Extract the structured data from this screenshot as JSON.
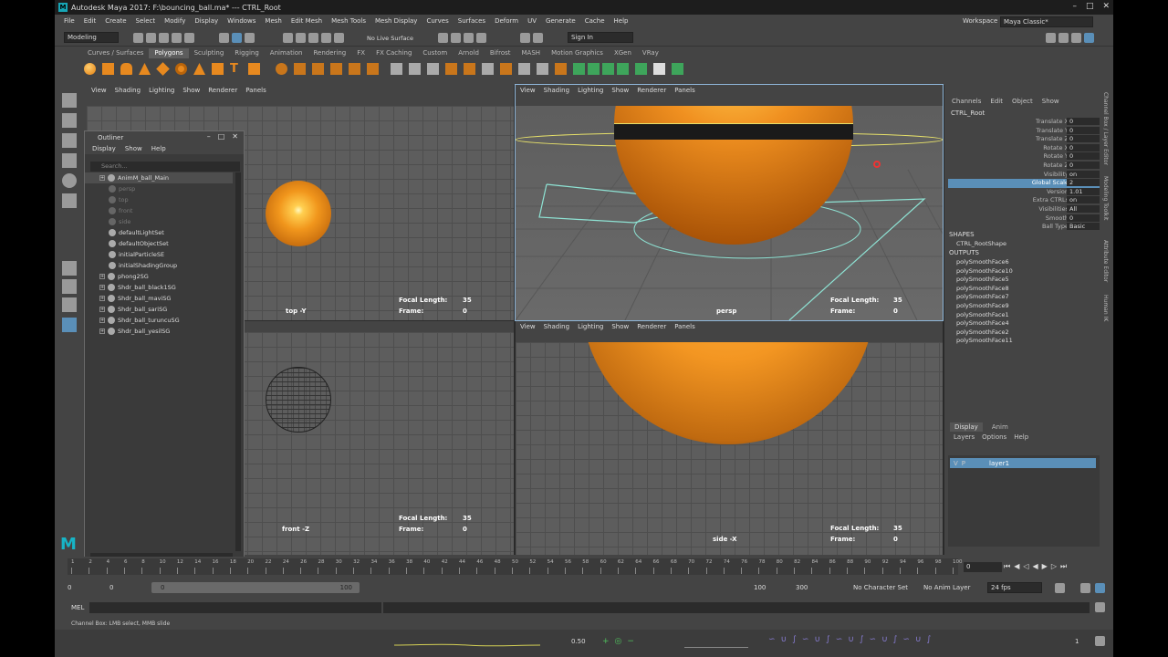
{
  "window": {
    "title": "Autodesk Maya 2017: F:\\bouncing_ball.ma*  ---  CTRL_Root"
  },
  "menu": [
    "File",
    "Edit",
    "Create",
    "Select",
    "Modify",
    "Display",
    "Windows",
    "Mesh",
    "Edit Mesh",
    "Mesh Tools",
    "Mesh Display",
    "Curves",
    "Surfaces",
    "Deform",
    "UV",
    "Generate",
    "Cache",
    "Help"
  ],
  "workspace": {
    "label": "Workspace :",
    "value": "Maya Classic*"
  },
  "status": {
    "mode": "Modeling",
    "live": "No Live Surface",
    "signin": "Sign In"
  },
  "shelf_tabs": [
    "Curves / Surfaces",
    "Polygons",
    "Sculpting",
    "Rigging",
    "Animation",
    "Rendering",
    "FX",
    "FX Caching",
    "Custom",
    "Arnold",
    "Bifrost",
    "MASH",
    "Motion Graphics",
    "XGen",
    "VRay"
  ],
  "shelf_active": "Polygons",
  "panel_menu": [
    "View",
    "Shading",
    "Lighting",
    "Show",
    "Renderer",
    "Panels"
  ],
  "viewports": {
    "top": {
      "cam": "top -Y",
      "focal_label": "Focal Length:",
      "focal": "35",
      "frame_label": "Frame:",
      "frame": "0"
    },
    "persp": {
      "cam": "persp",
      "focal_label": "Focal Length:",
      "focal": "35",
      "frame_label": "Frame:",
      "frame": "0"
    },
    "front": {
      "cam": "front -Z",
      "focal_label": "Focal Length:",
      "focal": "35",
      "frame_label": "Frame:",
      "frame": "0"
    },
    "side": {
      "cam": "side -X",
      "focal_label": "Focal Length:",
      "focal": "35",
      "frame_label": "Frame:",
      "frame": "0"
    }
  },
  "outliner": {
    "title": "Outliner",
    "menu": [
      "Display",
      "Show",
      "Help"
    ],
    "search": "Search...",
    "items": [
      {
        "name": "AnimM_ball_Main",
        "expand": true,
        "dim": false
      },
      {
        "name": "persp",
        "expand": false,
        "dim": true
      },
      {
        "name": "top",
        "expand": false,
        "dim": true
      },
      {
        "name": "front",
        "expand": false,
        "dim": true
      },
      {
        "name": "side",
        "expand": false,
        "dim": true
      },
      {
        "name": "defaultLightSet",
        "expand": false,
        "dim": false
      },
      {
        "name": "defaultObjectSet",
        "expand": false,
        "dim": false
      },
      {
        "name": "initialParticleSE",
        "expand": false,
        "dim": false
      },
      {
        "name": "initialShadingGroup",
        "expand": false,
        "dim": false
      },
      {
        "name": "phong2SG",
        "expand": true,
        "dim": false
      },
      {
        "name": "Shdr_ball_black1SG",
        "expand": true,
        "dim": false
      },
      {
        "name": "Shdr_ball_maviSG",
        "expand": true,
        "dim": false
      },
      {
        "name": "Shdr_ball_sariSG",
        "expand": true,
        "dim": false
      },
      {
        "name": "Shdr_ball_turuncuSG",
        "expand": true,
        "dim": false
      },
      {
        "name": "Shdr_ball_yesilSG",
        "expand": true,
        "dim": false
      }
    ]
  },
  "channel_box": {
    "tabs": [
      "Channels",
      "Edit",
      "Object",
      "Show"
    ],
    "node": "CTRL_Root",
    "attrs": [
      {
        "l": "Translate X",
        "v": "0"
      },
      {
        "l": "Translate Y",
        "v": "0"
      },
      {
        "l": "Translate Z",
        "v": "0"
      },
      {
        "l": "Rotate X",
        "v": "0"
      },
      {
        "l": "Rotate Y",
        "v": "0"
      },
      {
        "l": "Rotate Z",
        "v": "0"
      },
      {
        "l": "Visibility",
        "v": "on"
      },
      {
        "l": "Global Scale",
        "v": "2"
      },
      {
        "l": "Version",
        "v": "1.01"
      },
      {
        "l": "Extra CTRLs",
        "v": "on"
      },
      {
        "l": "Visibilities",
        "v": "All"
      },
      {
        "l": "Smooth",
        "v": "0"
      },
      {
        "l": "Ball Type",
        "v": "Basic"
      }
    ],
    "shapes_label": "SHAPES",
    "shape": "CTRL_RootShape",
    "outputs_label": "OUTPUTS",
    "outputs": [
      "polySmoothFace6",
      "polySmoothFace10",
      "polySmoothFace5",
      "polySmoothFace8",
      "polySmoothFace7",
      "polySmoothFace9",
      "polySmoothFace1",
      "polySmoothFace4",
      "polySmoothFace2",
      "polySmoothFace11"
    ]
  },
  "layer_editor": {
    "tabs": [
      "Display",
      "Anim"
    ],
    "menu": [
      "Layers",
      "Options",
      "Help"
    ],
    "layer": "layer1",
    "v": "V",
    "p": "P"
  },
  "side_tabs": [
    "Channel Box / Layer Editor",
    "Modeling Toolkit",
    "Attribute Editor",
    "Human IK"
  ],
  "timeline": {
    "ticks": [
      "1",
      "2",
      "4",
      "6",
      "8",
      "10",
      "12",
      "14",
      "16",
      "18",
      "20",
      "22",
      "24",
      "26",
      "28",
      "30",
      "32",
      "34",
      "36",
      "38",
      "40",
      "42",
      "44",
      "46",
      "48",
      "50",
      "52",
      "54",
      "56",
      "58",
      "60",
      "62",
      "64",
      "66",
      "68",
      "70",
      "72",
      "74",
      "76",
      "78",
      "80",
      "82",
      "84",
      "86",
      "88",
      "90",
      "92",
      "94",
      "96",
      "98",
      "100"
    ],
    "current": "0"
  },
  "range": {
    "start": "0",
    "s2": "0",
    "inner_start": "0",
    "inner_end": "100",
    "end": "100",
    "end2": "300",
    "char": "No Character Set",
    "anim": "No Anim Layer",
    "fps": "24 fps"
  },
  "cmd": {
    "label": "MEL"
  },
  "help": "Channel Box: LMB select, MMB slide",
  "bottom": {
    "value": "0.50",
    "num": "1"
  }
}
